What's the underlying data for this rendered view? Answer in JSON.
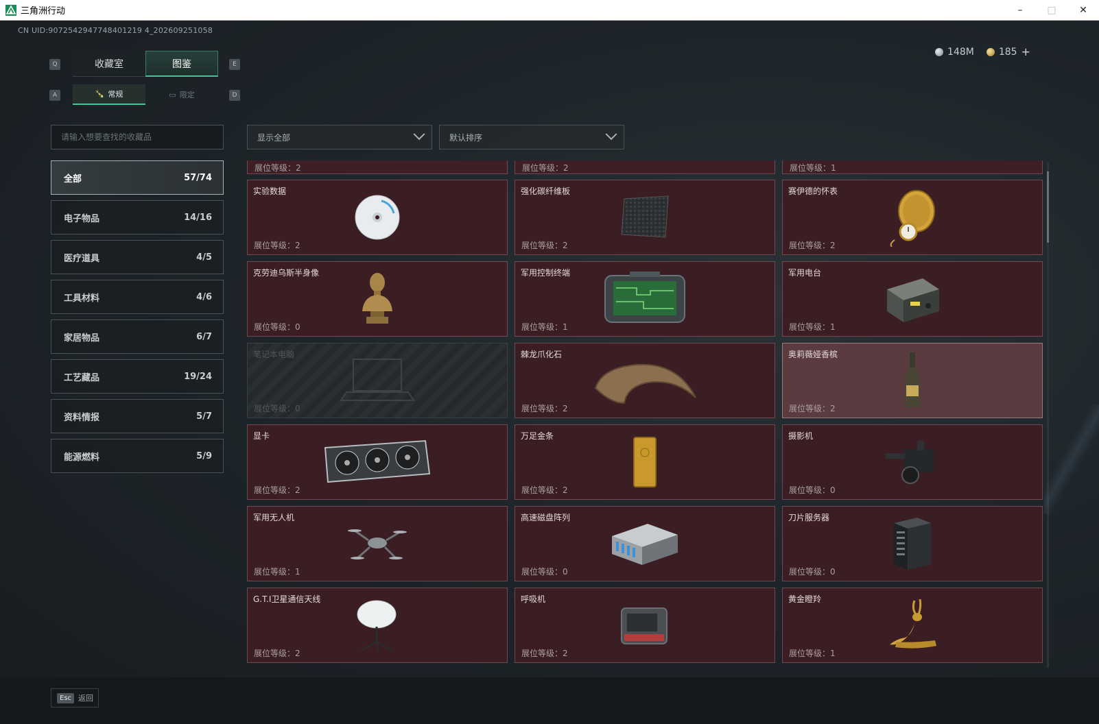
{
  "window": {
    "title": "三角洲行动",
    "minimize": "–",
    "maximize": "□",
    "close": "✕"
  },
  "uid": "CN UID:9072542947748401219 4_202609251058",
  "currency": {
    "silver": "148M",
    "gold": "185",
    "plus": "+"
  },
  "keys": {
    "left_main": "Q",
    "right_main": "E",
    "left_sub": "A",
    "right_sub": "D",
    "esc": "Esc"
  },
  "main_tabs": [
    {
      "label": "收藏室"
    },
    {
      "label": "图鉴"
    }
  ],
  "sub_tabs": [
    {
      "label": "常规",
      "icon": "bottle-icon"
    },
    {
      "label": "限定",
      "icon": "card-icon"
    }
  ],
  "search": {
    "placeholder": "请输入想要查找的收藏品",
    "value": ""
  },
  "filter": {
    "display": "显示全部",
    "sort": "默认排序"
  },
  "categories": [
    {
      "label": "全部",
      "count": "57/74"
    },
    {
      "label": "电子物品",
      "count": "14/16"
    },
    {
      "label": "医疗道具",
      "count": "4/5"
    },
    {
      "label": "工具材料",
      "count": "4/6"
    },
    {
      "label": "家居物品",
      "count": "6/7"
    },
    {
      "label": "工艺藏品",
      "count": "19/24"
    },
    {
      "label": "资料情报",
      "count": "5/7"
    },
    {
      "label": "能源燃料",
      "count": "5/9"
    }
  ],
  "partial_row": [
    "展位等级：2",
    "展位等级：2",
    "展位等级：1"
  ],
  "items": [
    {
      "name": "实验数据",
      "level": "展位等级：2",
      "icon": "disc-icon"
    },
    {
      "name": "强化碳纤维板",
      "level": "展位等级：2",
      "icon": "carbon-plate-icon"
    },
    {
      "name": "赛伊德的怀表",
      "level": "展位等级：2",
      "icon": "pocket-watch-icon"
    },
    {
      "name": "克劳迪乌斯半身像",
      "level": "展位等级：0",
      "icon": "bust-icon"
    },
    {
      "name": "军用控制终端",
      "level": "展位等级：1",
      "icon": "control-terminal-icon"
    },
    {
      "name": "军用电台",
      "level": "展位等级：1",
      "icon": "radio-icon"
    },
    {
      "name": "笔记本电脑",
      "level": "展位等级：0",
      "icon": "laptop-icon"
    },
    {
      "name": "棘龙爪化石",
      "level": "展位等级：2",
      "icon": "claw-fossil-icon"
    },
    {
      "name": "奥莉薇娅香槟",
      "level": "展位等级：2",
      "icon": "champagne-icon"
    },
    {
      "name": "显卡",
      "level": "展位等级：2",
      "icon": "gpu-icon"
    },
    {
      "name": "万足金条",
      "level": "展位等级：2",
      "icon": "gold-bar-icon"
    },
    {
      "name": "摄影机",
      "level": "展位等级：0",
      "icon": "camera-icon"
    },
    {
      "name": "军用无人机",
      "level": "展位等级：1",
      "icon": "drone-icon"
    },
    {
      "name": "高速磁盘阵列",
      "level": "展位等级：0",
      "icon": "disk-array-icon"
    },
    {
      "name": "刀片服务器",
      "level": "展位等级：0",
      "icon": "server-icon"
    },
    {
      "name": "G.T.I卫星通信天线",
      "level": "展位等级：2",
      "icon": "satellite-dish-icon"
    },
    {
      "name": "呼吸机",
      "level": "展位等级：2",
      "icon": "ventilator-icon"
    },
    {
      "name": "黄金瞪羚",
      "level": "展位等级：1",
      "icon": "gold-gazelle-icon"
    }
  ],
  "footer": {
    "back": "返回"
  }
}
